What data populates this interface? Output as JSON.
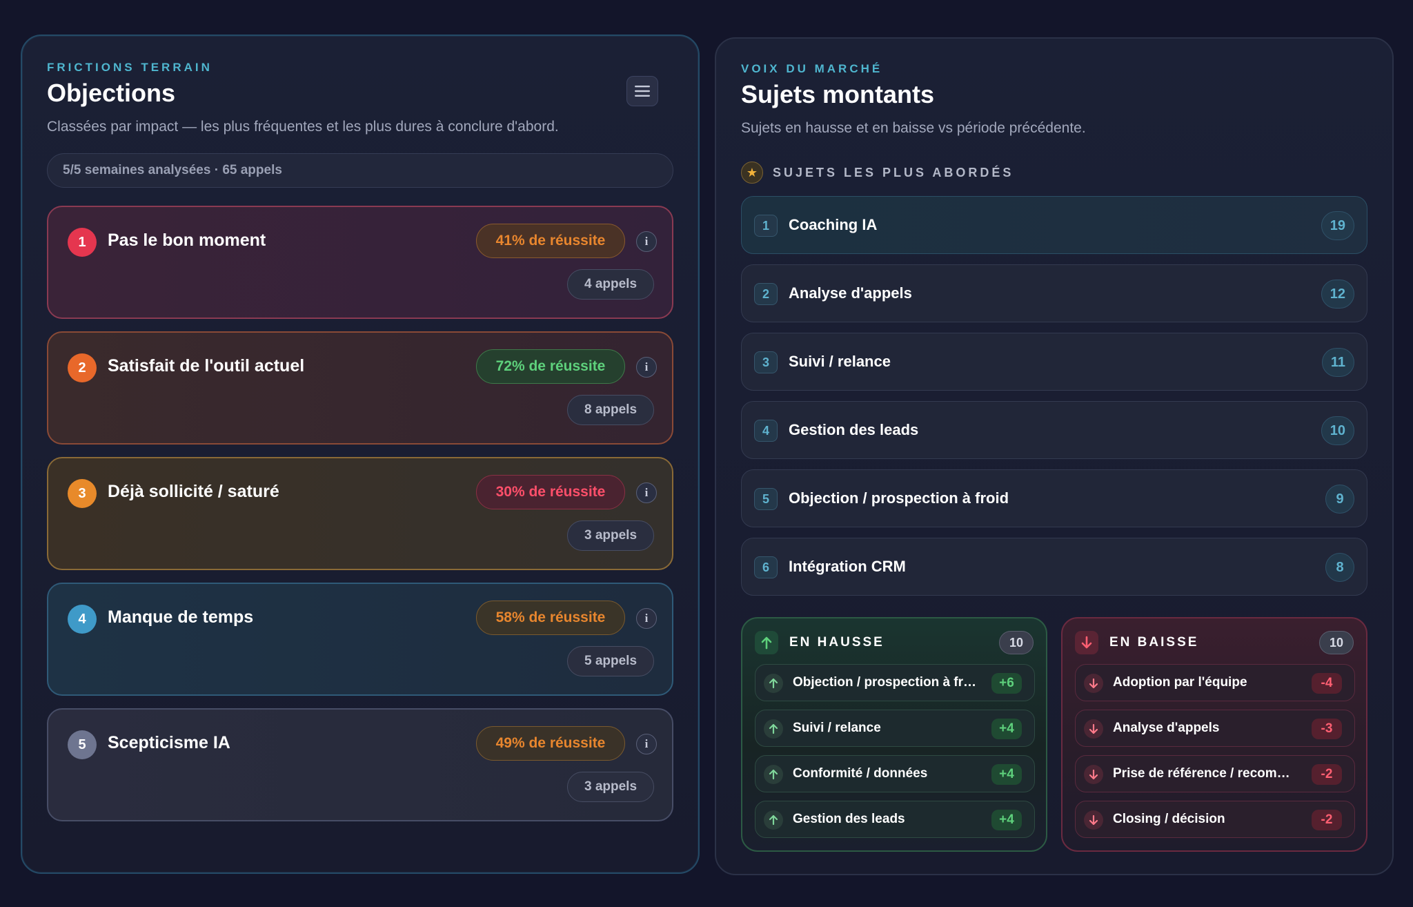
{
  "objections_panel": {
    "eyebrow": "FRICTIONS TERRAIN",
    "title": "Objections",
    "subtitle": "Classées par impact — les plus fréquentes et les plus dures à conclure d'abord.",
    "summary": "5/5 semaines analysées · 65 appels",
    "menu_icon": "hamburger-menu-icon",
    "items": [
      {
        "rank": "1",
        "title": "Pas le bon moment",
        "success": "41% de réussite",
        "calls": "4 appels",
        "info": "i",
        "tone": "orange",
        "accent": "#e5364f"
      },
      {
        "rank": "2",
        "title": "Satisfait de l'outil actuel",
        "success": "72% de réussite",
        "calls": "8 appels",
        "info": "i",
        "tone": "green",
        "accent": "#e8682a"
      },
      {
        "rank": "3",
        "title": "Déjà sollicité / saturé",
        "success": "30% de réussite",
        "calls": "3 appels",
        "info": "i",
        "tone": "red",
        "accent": "#e88a2a"
      },
      {
        "rank": "4",
        "title": "Manque de temps",
        "success": "58% de réussite",
        "calls": "5 appels",
        "info": "i",
        "tone": "orange",
        "accent": "#3f9ac8"
      },
      {
        "rank": "5",
        "title": "Scepticisme IA",
        "success": "49% de réussite",
        "calls": "3 appels",
        "info": "i",
        "tone": "orange",
        "accent": "#6e7590"
      }
    ]
  },
  "topics_panel": {
    "eyebrow": "VOIX DU MARCHÉ",
    "title": "Sujets montants",
    "subtitle": "Sujets en hausse et en baisse vs période précédente.",
    "section_label": "SUJETS LES PLUS ABORDÉS",
    "section_icon": "star-icon",
    "topics": [
      {
        "rank": "1",
        "label": "Coaching IA",
        "count": "19"
      },
      {
        "rank": "2",
        "label": "Analyse d'appels",
        "count": "12"
      },
      {
        "rank": "3",
        "label": "Suivi / relance",
        "count": "11"
      },
      {
        "rank": "4",
        "label": "Gestion des leads",
        "count": "10"
      },
      {
        "rank": "5",
        "label": "Objection / prospection à froid",
        "count": "9"
      },
      {
        "rank": "6",
        "label": "Intégration CRM",
        "count": "8"
      }
    ],
    "rising": {
      "title": "EN HAUSSE",
      "count": "10",
      "icon": "arrow-up-icon",
      "items": [
        {
          "label": "Objection / prospection à froid",
          "delta": "+6"
        },
        {
          "label": "Suivi / relance",
          "delta": "+4"
        },
        {
          "label": "Conformité / données",
          "delta": "+4"
        },
        {
          "label": "Gestion des leads",
          "delta": "+4"
        }
      ]
    },
    "falling": {
      "title": "EN BAISSE",
      "count": "10",
      "icon": "arrow-down-icon",
      "items": [
        {
          "label": "Adoption par l'équipe",
          "delta": "-4"
        },
        {
          "label": "Analyse d'appels",
          "delta": "-3"
        },
        {
          "label": "Prise de référence / recommandation",
          "delta": "-2"
        },
        {
          "label": "Closing / décision",
          "delta": "-2"
        }
      ]
    }
  },
  "colors": {
    "background": "#13152a",
    "accent_teal": "#4fb6cf",
    "success_green": "#5ed17c",
    "danger_red": "#ff5f72",
    "warning_orange": "#e8862e"
  }
}
